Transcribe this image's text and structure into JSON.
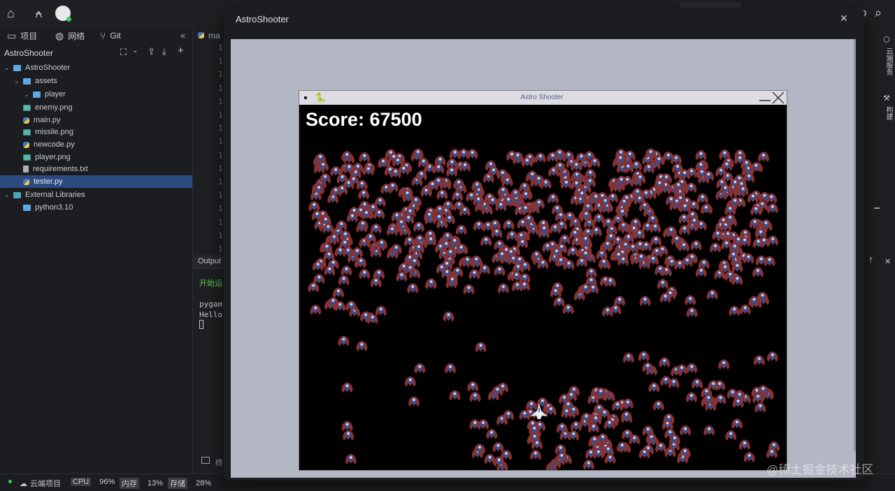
{
  "panel": {
    "tabs": [
      {
        "label": "项目",
        "icon": "folder-icon"
      },
      {
        "label": "网络",
        "icon": "globe-icon"
      },
      {
        "label": "Git",
        "icon": "branch-icon"
      }
    ],
    "project_name": "AstroShooter",
    "tree": [
      {
        "label": "AstroShooter",
        "type": "folder",
        "depth": 0,
        "expanded": true
      },
      {
        "label": "assets",
        "type": "folder",
        "depth": 1,
        "expanded": true
      },
      {
        "label": "player",
        "type": "folder",
        "depth": 2,
        "expanded": true
      },
      {
        "label": "enemy.png",
        "type": "img",
        "depth": 1
      },
      {
        "label": "main.py",
        "type": "py",
        "depth": 1
      },
      {
        "label": "missile.png",
        "type": "img",
        "depth": 1
      },
      {
        "label": "newcode.py",
        "type": "py",
        "depth": 1
      },
      {
        "label": "player.png",
        "type": "img",
        "depth": 1
      },
      {
        "label": "requirements.txt",
        "type": "txt",
        "depth": 1
      },
      {
        "label": "tester.py",
        "type": "py",
        "depth": 1,
        "selected": true
      },
      {
        "label": "External Libraries",
        "type": "lib",
        "depth": 0,
        "expanded": true
      },
      {
        "label": "python3.10",
        "type": "folder",
        "depth": 1
      }
    ]
  },
  "editor": {
    "tab_label": "ma",
    "line_number_glyph": "1"
  },
  "output": {
    "header": "Output",
    "lines": [
      {
        "text": "开始运",
        "color": "#5fcf52"
      },
      {
        "text": "pygam",
        "color": "#c8cbcf"
      },
      {
        "text": "Hello",
        "color": "#c8cbcf"
      }
    ]
  },
  "terminal_label": "终",
  "right_strip": {
    "items": [
      "云端服务",
      "构建"
    ]
  },
  "status": {
    "cloud_label": "云端项目",
    "cpu_key": "CPU",
    "cpu_val": "96%",
    "mem_key": "内存",
    "mem_val": "13%",
    "disk_key": "存储",
    "disk_val": "28%"
  },
  "dialog": {
    "title": "AstroShooter"
  },
  "game": {
    "title": "Astro Shooter",
    "score_text": "Score: 67500",
    "enemy_count_estimate": 700
  },
  "watermark": "@稀土掘金技术社区",
  "colors": {
    "selection": "#2d4a80",
    "game_bg": "#000000",
    "dialog_bg": "#b3b6c3"
  }
}
